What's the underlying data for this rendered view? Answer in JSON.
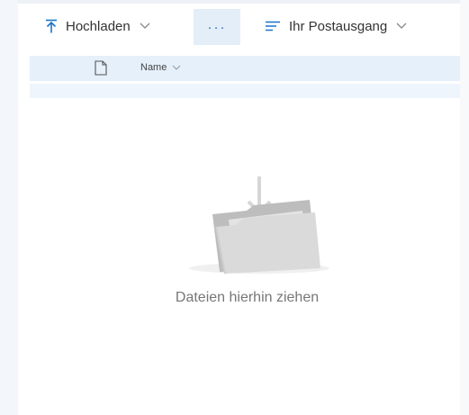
{
  "toolbar": {
    "upload_label": "Hochladen",
    "more_label": "···",
    "sort_label": "Ihr Postausgang"
  },
  "list": {
    "column_name": "Name"
  },
  "empty_state": {
    "message": "Dateien hierhin ziehen"
  },
  "icons": {
    "upload": "upload-icon",
    "more": "ellipsis-icon",
    "sort": "sort-lines-icon",
    "file": "file-icon",
    "folder": "folder-drop-icon"
  },
  "colors": {
    "accent": "#1a73c8",
    "selected_bg": "#e3eef9",
    "header_bg": "#e5f0fa"
  }
}
